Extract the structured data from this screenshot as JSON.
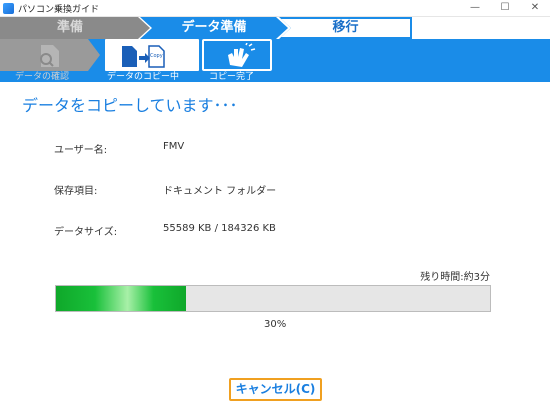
{
  "window": {
    "title": "パソコン乗換ガイド",
    "minimize": "—",
    "maximize": "☐",
    "close": "✕"
  },
  "steps": {
    "prep": "準備",
    "data": "データ準備",
    "move": "移行"
  },
  "substeps": {
    "check": "データの確認",
    "copying": "データのコピー中",
    "done": "コピー完了"
  },
  "heading": "データをコピーしています･･･",
  "info": {
    "user_label": "ユーザー名:",
    "user_value": "FMV",
    "items_label": "保存項目:",
    "items_value": "ドキュメント フォルダー",
    "size_label": "データサイズ:",
    "size_value": "55589 KB / 184326 KB"
  },
  "progress": {
    "remaining": "残り時間:約3分",
    "percent_text": "30%",
    "value": 0.3
  },
  "cancel_label": "キャンセル(C)"
}
